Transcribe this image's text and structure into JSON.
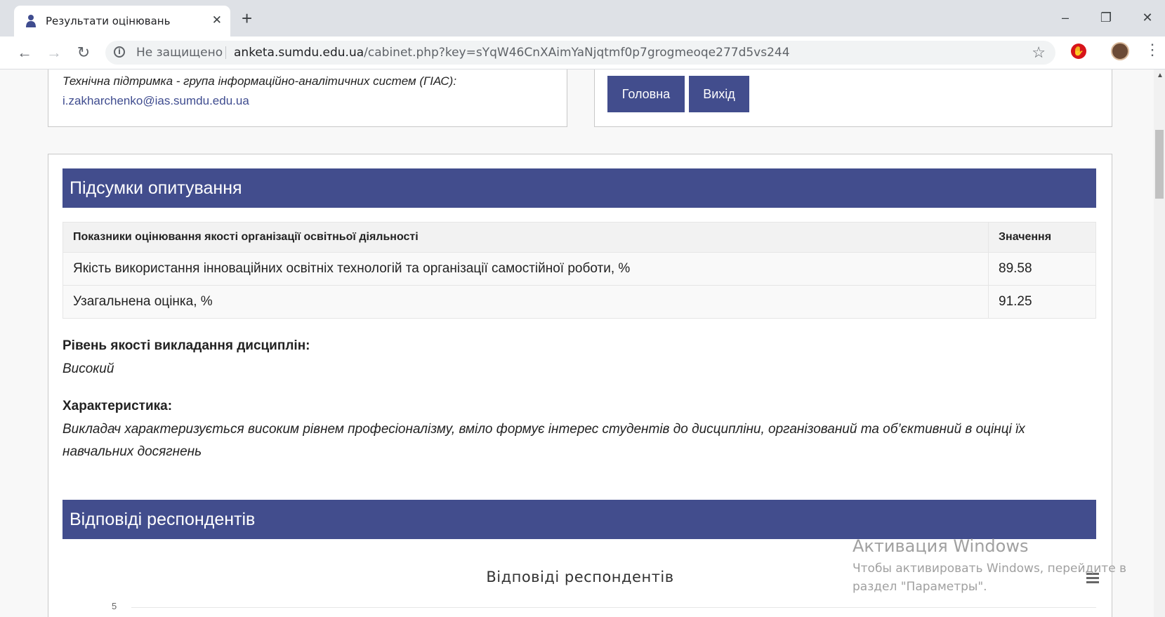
{
  "browser": {
    "tab_title": "Результати оцінювань",
    "tab_close": "✕",
    "new_tab": "+",
    "window_controls": {
      "minimize": "–",
      "restore": "❐",
      "close": "✕"
    },
    "nav": {
      "back": "←",
      "forward": "→",
      "reload": "↻"
    },
    "security_text": "Не защищено",
    "url_host": "anketa.sumdu.edu.ua",
    "url_path": "/cabinet.php?key=sYqW46CnXAimYaNjqtmf0p7grogmeoqe277d5vs244",
    "star": "☆",
    "menu": "⋮"
  },
  "support": {
    "text": "Технічна підтримка - група інформаційно-аналітичних систем (ГІАС):",
    "email": "i.zakharchenko@ias.sumdu.edu.ua"
  },
  "actions": {
    "home_label": "Головна",
    "logout_label": "Вихід"
  },
  "summary": {
    "heading": "Підсумки опитування",
    "table": {
      "headers": [
        "Показники оцінювання якості організації освітньої діяльності",
        "Значення"
      ],
      "rows": [
        [
          "Якість використання інноваційних освітніх технологій та організації самостійної роботи, %",
          "89.58"
        ],
        [
          "Узагальнена оцінка, %",
          "91.25"
        ]
      ]
    },
    "level_label": "Рівень якості викладання дисциплін:",
    "level_value": "Високий",
    "characteristic_label": "Характеристика:",
    "characteristic_value": "Викладач характеризується високим рівнем професіоналізму, вміло формує інтерес студентів до дисципліни, організований та об’єктивний в оцінці їх навчальних досягнень"
  },
  "responses": {
    "heading": "Відповіді респондентів"
  },
  "chart_data": {
    "type": "bar",
    "title": "Відповіді респондентів",
    "y_ticks_visible": [
      "5"
    ]
  },
  "watermark": {
    "title": "Активация Windows",
    "line1": "Чтобы активировать Windows, перейдите в",
    "line2": "раздел \"Параметры\"."
  },
  "colors": {
    "accent": "#424d8d",
    "link": "#3f4c8f",
    "tab_strip": "#dee1e6"
  }
}
